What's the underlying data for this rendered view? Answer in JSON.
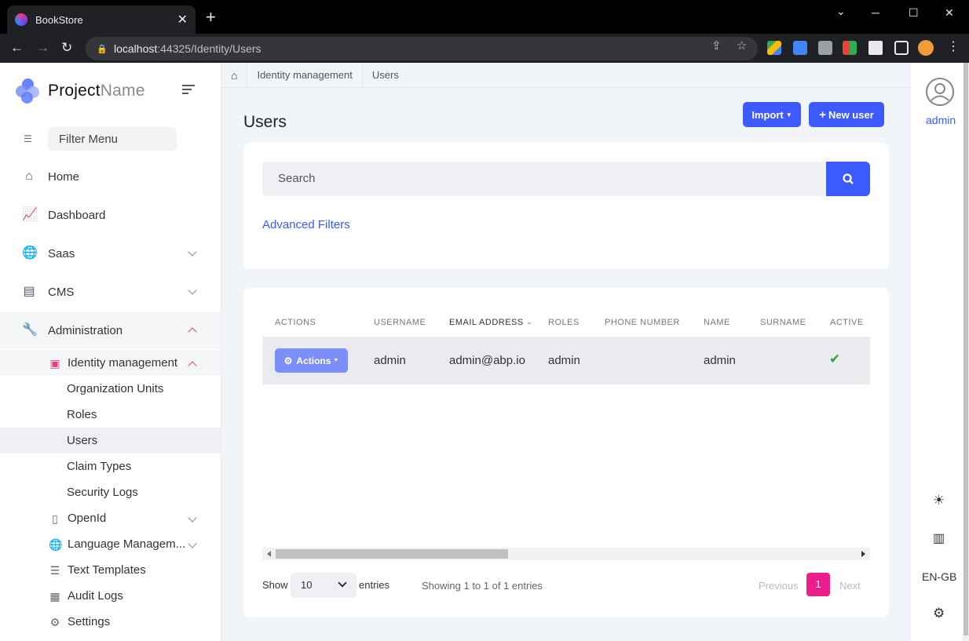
{
  "browser": {
    "tab_title": "BookStore",
    "tab_close": "✕",
    "new_tab": "+",
    "url_host": "localhost",
    "url_rest": ":44325/Identity/Users",
    "window_min": "─",
    "window_max": "☐",
    "window_close": "✕",
    "chevron": "⌄"
  },
  "brand": {
    "name_bold": "Project",
    "name_light": "Name"
  },
  "sidebar": {
    "filter_placeholder": "Filter Menu",
    "items": [
      {
        "label": "Home",
        "icon": "home-icon"
      },
      {
        "label": "Dashboard",
        "icon": "chart-icon"
      },
      {
        "label": "Saas",
        "icon": "globe-icon"
      },
      {
        "label": "CMS",
        "icon": "cms-icon"
      },
      {
        "label": "Administration",
        "icon": "wrench-icon"
      }
    ],
    "identity": {
      "label": "Identity management"
    },
    "identity_children": [
      "Organization Units",
      "Roles",
      "Users",
      "Claim Types",
      "Security Logs"
    ],
    "admin_children": [
      {
        "label": "OpenId",
        "icon": "openid-icon"
      },
      {
        "label": "Language Managem...",
        "icon": "globe-icon"
      },
      {
        "label": "Text Templates",
        "icon": "text-template-icon"
      },
      {
        "label": "Audit Logs",
        "icon": "file-icon"
      },
      {
        "label": "Settings",
        "icon": "gear-icon"
      }
    ]
  },
  "breadcrumb": {
    "items": [
      "Identity management",
      "Users"
    ]
  },
  "page": {
    "title": "Users",
    "import_label": "Import",
    "new_user_label": "New user",
    "search_placeholder": "Search",
    "advanced_filters": "Advanced Filters"
  },
  "table": {
    "columns": [
      "ACTIONS",
      "USERNAME",
      "EMAIL ADDRESS",
      "ROLES",
      "PHONE NUMBER",
      "NAME",
      "SURNAME",
      "ACTIVE"
    ],
    "rows": [
      {
        "actions": "Actions",
        "username": "admin",
        "email": "admin@abp.io",
        "roles": "admin",
        "phone": "",
        "name": "admin",
        "surname": "",
        "active": "✔"
      }
    ]
  },
  "footer": {
    "show": "Show",
    "page_size": "10",
    "entries": "entries",
    "info": "Showing 1 to 1 of 1 entries",
    "previous": "Previous",
    "current_page": "1",
    "next": "Next"
  },
  "right_rail": {
    "user": "admin",
    "language": "EN-GB"
  },
  "colors": {
    "primary": "#3d5afe",
    "accent": "#ec1c8c",
    "success": "#28a745"
  }
}
